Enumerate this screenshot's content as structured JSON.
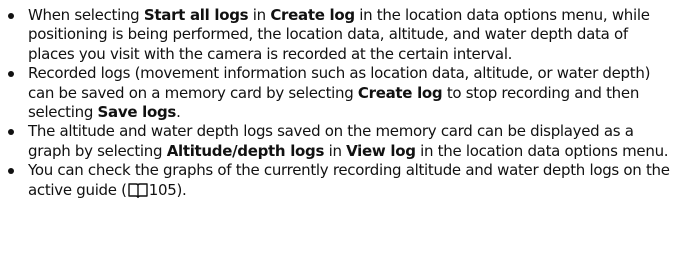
{
  "items": [
    {
      "segments": [
        {
          "text": "When selecting ",
          "bold": false
        },
        {
          "text": "Start all logs",
          "bold": true
        },
        {
          "text": " in ",
          "bold": false
        },
        {
          "text": "Create log",
          "bold": true
        },
        {
          "text": " in the location data options menu, while positioning is being performed, the location data, altitude, and water depth data of places you visit with the camera is recorded at the certain interval.",
          "bold": false
        }
      ]
    },
    {
      "segments": [
        {
          "text": "Recorded logs (movement information such as location data, altitude, or water depth) can be saved on a memory card by selecting ",
          "bold": false
        },
        {
          "text": "Create log",
          "bold": true
        },
        {
          "text": " to stop recording and then selecting ",
          "bold": false
        },
        {
          "text": "Save logs",
          "bold": true
        },
        {
          "text": ".",
          "bold": false
        }
      ]
    },
    {
      "segments": [
        {
          "text": "The altitude and water depth logs saved on the memory card can be displayed as a graph by selecting ",
          "bold": false
        },
        {
          "text": "Altitude/depth logs",
          "bold": true
        },
        {
          "text": " in ",
          "bold": false
        },
        {
          "text": "View log",
          "bold": true
        },
        {
          "text": " in the location data options menu.",
          "bold": false
        }
      ]
    },
    {
      "segments": [
        {
          "text": "You can check the graphs of the currently recording altitude and water depth logs on the active guide (",
          "bold": false
        },
        {
          "icon": "book-reference-icon"
        },
        {
          "text": "105).",
          "bold": false
        }
      ]
    }
  ]
}
